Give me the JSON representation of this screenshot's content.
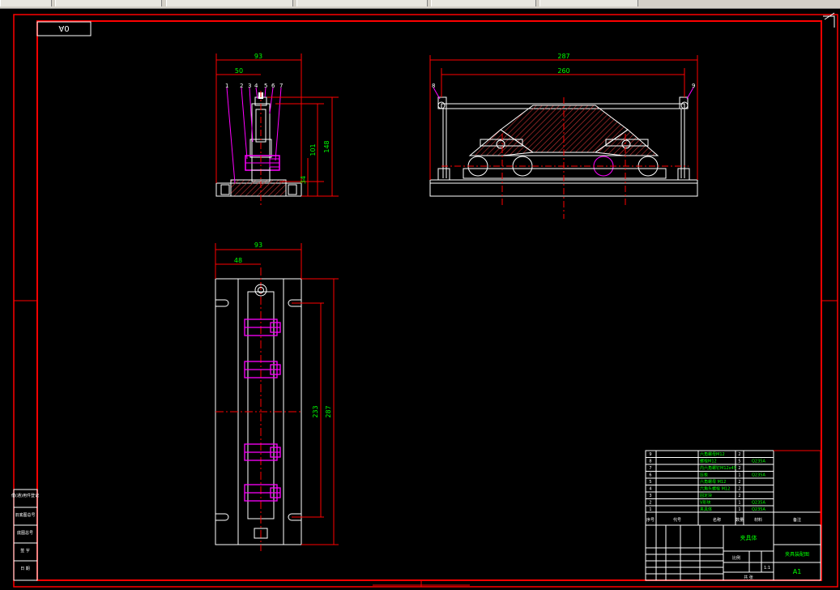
{
  "sheet": {
    "size_box": "0A",
    "sheet_size": "A1",
    "dim_color": "#00ff00",
    "frame_color": "#ff0000",
    "line_color": "#ffffff",
    "hatch_color": "#cc3333",
    "accent_color": "#ff00ff"
  },
  "front_view": {
    "dims": {
      "overall_width": "93",
      "offset": "50",
      "height_total": "148",
      "height_upper": "101",
      "height_base": "34"
    },
    "balloons": [
      "1",
      "2",
      "3",
      "4",
      "5",
      "6",
      "7"
    ]
  },
  "side_view": {
    "dims": {
      "overall": "287",
      "inner": "260"
    },
    "balloons": [
      "8",
      "9"
    ]
  },
  "top_view": {
    "dims": {
      "width": "93",
      "offset": "48",
      "inner_length": "233",
      "overall_length": "287"
    }
  },
  "parts_list": {
    "rows": [
      {
        "no": "9",
        "name": "六角螺母M12",
        "qty": "2",
        "material": ""
      },
      {
        "no": "8",
        "name": "螺栓M12",
        "qty": "5",
        "material": "Q235A"
      },
      {
        "no": "7",
        "name": "内六角螺钉M12x45",
        "qty": "2",
        "material": ""
      },
      {
        "no": "6",
        "name": "压板",
        "qty": "1",
        "material": "Q235A"
      },
      {
        "no": "5",
        "name": "六角螺母 M12",
        "qty": "2",
        "material": ""
      },
      {
        "no": "4",
        "name": "六角头螺栓 M12",
        "qty": "2",
        "material": ""
      },
      {
        "no": "3",
        "name": "固定块",
        "qty": "2",
        "material": ""
      },
      {
        "no": "2",
        "name": "V形块",
        "qty": "1",
        "material": "Q235A"
      },
      {
        "no": "1",
        "name": "夹具体",
        "qty": "1",
        "material": "Q235A"
      }
    ],
    "header": {
      "no": "序号",
      "code": "代号",
      "name": "名称",
      "qty": "数量",
      "material": "材料",
      "note": "备注"
    }
  },
  "title_block": {
    "title": "夹具体",
    "drawing_name": "夹具装配图",
    "scale_label": "比例",
    "scale": "1:1",
    "sheet_label": "共 张",
    "mark": "A1"
  },
  "left_strip": [
    "借(通)用件登记",
    "旧底图总号",
    "底图总号",
    "签 字",
    "日 期"
  ]
}
